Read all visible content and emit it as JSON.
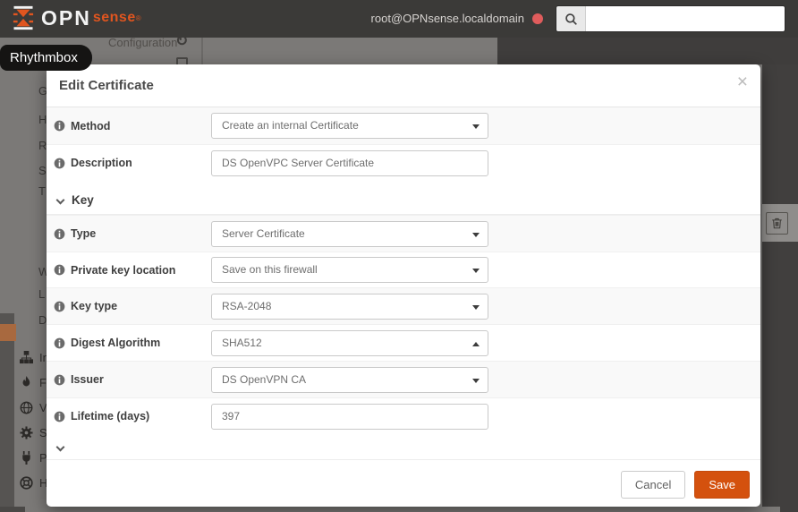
{
  "header": {
    "brand_primary": "OPN",
    "brand_secondary": "sense",
    "registered_mark": "®",
    "user": "root@OPNsense.localdomain",
    "search_value": ""
  },
  "desktop": {
    "tooltip": "Rhythmbox"
  },
  "background_page": {
    "header_fragment": "Configuration",
    "refresh_glyph": "↻",
    "sidebar_letter_fragments": [
      "G",
      "H",
      "R",
      "S",
      "T",
      "W",
      "L",
      "D"
    ],
    "sidebar_items": [
      {
        "icon": "sitemap-icon",
        "label": "Inte"
      },
      {
        "icon": "fire-icon",
        "label": "Fire"
      },
      {
        "icon": "globe-icon",
        "label": "VPN"
      },
      {
        "icon": "gear-icon",
        "label": "Serv"
      },
      {
        "icon": "plug-icon",
        "label": "Pow"
      },
      {
        "icon": "life-ring-icon",
        "label": "Hel"
      }
    ]
  },
  "modal": {
    "title": "Edit Certificate",
    "close_label": "×",
    "rows": [
      {
        "kind": "field",
        "label": "Method",
        "control": "select",
        "value": "Create an internal Certificate",
        "caret": "down"
      },
      {
        "kind": "field",
        "label": "Description",
        "control": "text",
        "value": "DS OpenVPC Server Certificate"
      },
      {
        "kind": "section",
        "label": "Key"
      },
      {
        "kind": "field",
        "label": "Type",
        "control": "select",
        "value": "Server Certificate",
        "caret": "down"
      },
      {
        "kind": "field",
        "label": "Private key location",
        "control": "select",
        "value": "Save on this firewall",
        "caret": "down"
      },
      {
        "kind": "field",
        "label": "Key type",
        "control": "select",
        "value": "RSA-2048",
        "caret": "down"
      },
      {
        "kind": "field",
        "label": "Digest Algorithm",
        "control": "select",
        "value": "SHA512",
        "caret": "up"
      },
      {
        "kind": "field",
        "label": "Issuer",
        "control": "select",
        "value": "DS OpenVPN CA",
        "caret": "down"
      },
      {
        "kind": "field",
        "label": "Lifetime (days)",
        "control": "text",
        "value": "397"
      }
    ],
    "buttons": {
      "cancel": "Cancel",
      "save": "Save"
    }
  },
  "colors": {
    "brand_orange": "#e0551f",
    "save_button": "#d4510e",
    "header_bg": "#3b3a38",
    "status_dot_red": "#e05c5c",
    "overlay_gray": "#7b7977",
    "overlay_dark": "#3f3d3c"
  }
}
